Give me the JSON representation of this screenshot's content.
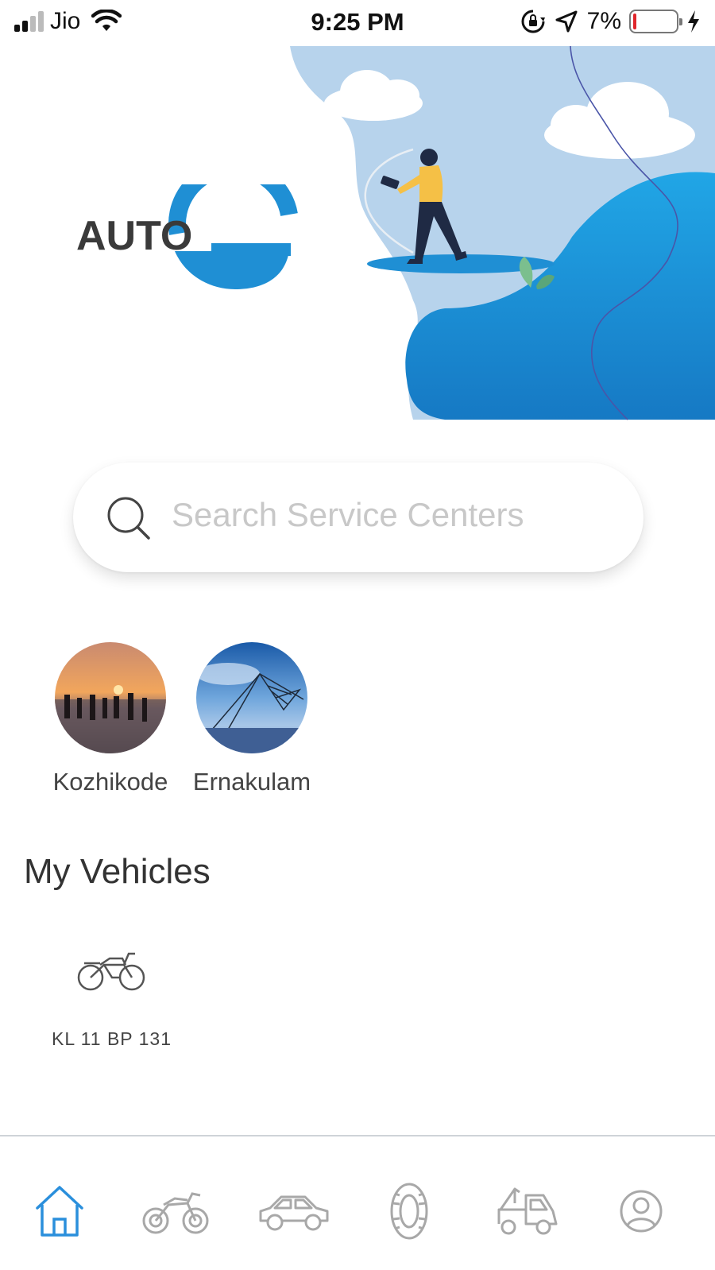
{
  "status_bar": {
    "carrier": "Jio",
    "time": "9:25 PM",
    "battery_percent": "7%",
    "battery_level": 0.07,
    "icons": [
      "signal-icon",
      "wifi-icon",
      "rotation-lock-icon",
      "location-arrow-icon",
      "battery-icon",
      "charging-bolt-icon"
    ]
  },
  "brand": {
    "logo_text": "AUTO",
    "logo_letter": "G",
    "accent_color": "#1f8fd4",
    "text_color": "#3a3a3a"
  },
  "search": {
    "placeholder": "Search Service Centers",
    "value": ""
  },
  "cities": [
    {
      "name": "Kozhikode",
      "image": "sunset-pier-photo"
    },
    {
      "name": "Ernakulam",
      "image": "fishing-net-photo"
    }
  ],
  "vehicles_section": {
    "title": "My Vehicles",
    "items": [
      {
        "plate": "KL 11 BP 131",
        "icon": "motorbike-icon"
      }
    ]
  },
  "bottom_nav": {
    "active_color": "#2a8fdc",
    "inactive_color": "#a8a8a8",
    "items": [
      {
        "id": "home",
        "icon": "home-icon",
        "active": true
      },
      {
        "id": "bike",
        "icon": "motorbike-icon",
        "active": false
      },
      {
        "id": "car",
        "icon": "car-icon",
        "active": false
      },
      {
        "id": "tyre",
        "icon": "tyre-icon",
        "active": false
      },
      {
        "id": "tow",
        "icon": "tow-truck-icon",
        "active": false
      },
      {
        "id": "profile",
        "icon": "profile-icon",
        "active": false
      }
    ]
  }
}
